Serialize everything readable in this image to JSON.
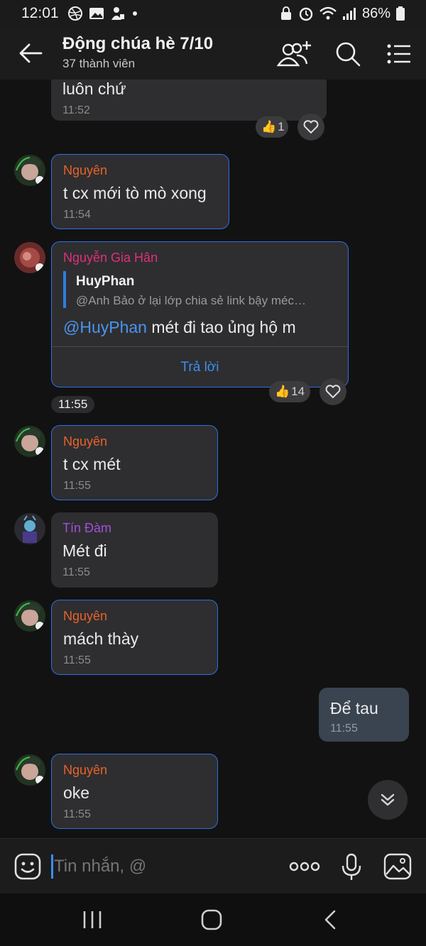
{
  "status_bar": {
    "time": "12:01",
    "battery": "86%"
  },
  "header": {
    "title": "Động chúa hè 7/10",
    "subtitle": "37 thành viên",
    "icons": [
      "back-arrow-icon",
      "add-member-icon",
      "search-icon",
      "menu-icon"
    ]
  },
  "messages": [
    {
      "sender": "",
      "text": "luôn chứ",
      "time": "11:52",
      "reaction": "1",
      "reaction_emoji": "👍"
    },
    {
      "sender": "Nguyên",
      "sender_color": "#e8622a",
      "text": "t cx mới tò mò xong",
      "time": "11:54"
    },
    {
      "sender": "Nguyễn Gia Hân",
      "sender_color": "#e0307a",
      "quote_author": "HuyPhan",
      "quote_text": "@Anh Bảo ở lại lớp chia sẻ link bậy méc…",
      "mention": "@HuyPhan",
      "text": " mét đi tao ủng hộ m",
      "reply_label": "Trả lời",
      "reaction": "14",
      "reaction_emoji": "👍",
      "time": "11:55"
    },
    {
      "sender": "Nguyên",
      "sender_color": "#e8622a",
      "text": "t cx mét",
      "time": "11:55"
    },
    {
      "sender": "Tín Đàm",
      "sender_color": "#a24fd8",
      "text": "Mét đi",
      "time": "11:55"
    },
    {
      "sender": "Nguyên",
      "sender_color": "#e8622a",
      "text": "mách thày",
      "time": "11:55"
    },
    {
      "sender": "",
      "text": "Để tau",
      "time": "11:55",
      "mine": true
    },
    {
      "sender": "Nguyên",
      "sender_color": "#e8622a",
      "text": "oke",
      "time": "11:55"
    }
  ],
  "composer": {
    "placeholder": "Tin nhắn, @"
  },
  "colors": {
    "accent": "#2f6ee0",
    "bubble": "#2e2e30",
    "my_bubble": "#3a4450",
    "background": "#121212"
  }
}
